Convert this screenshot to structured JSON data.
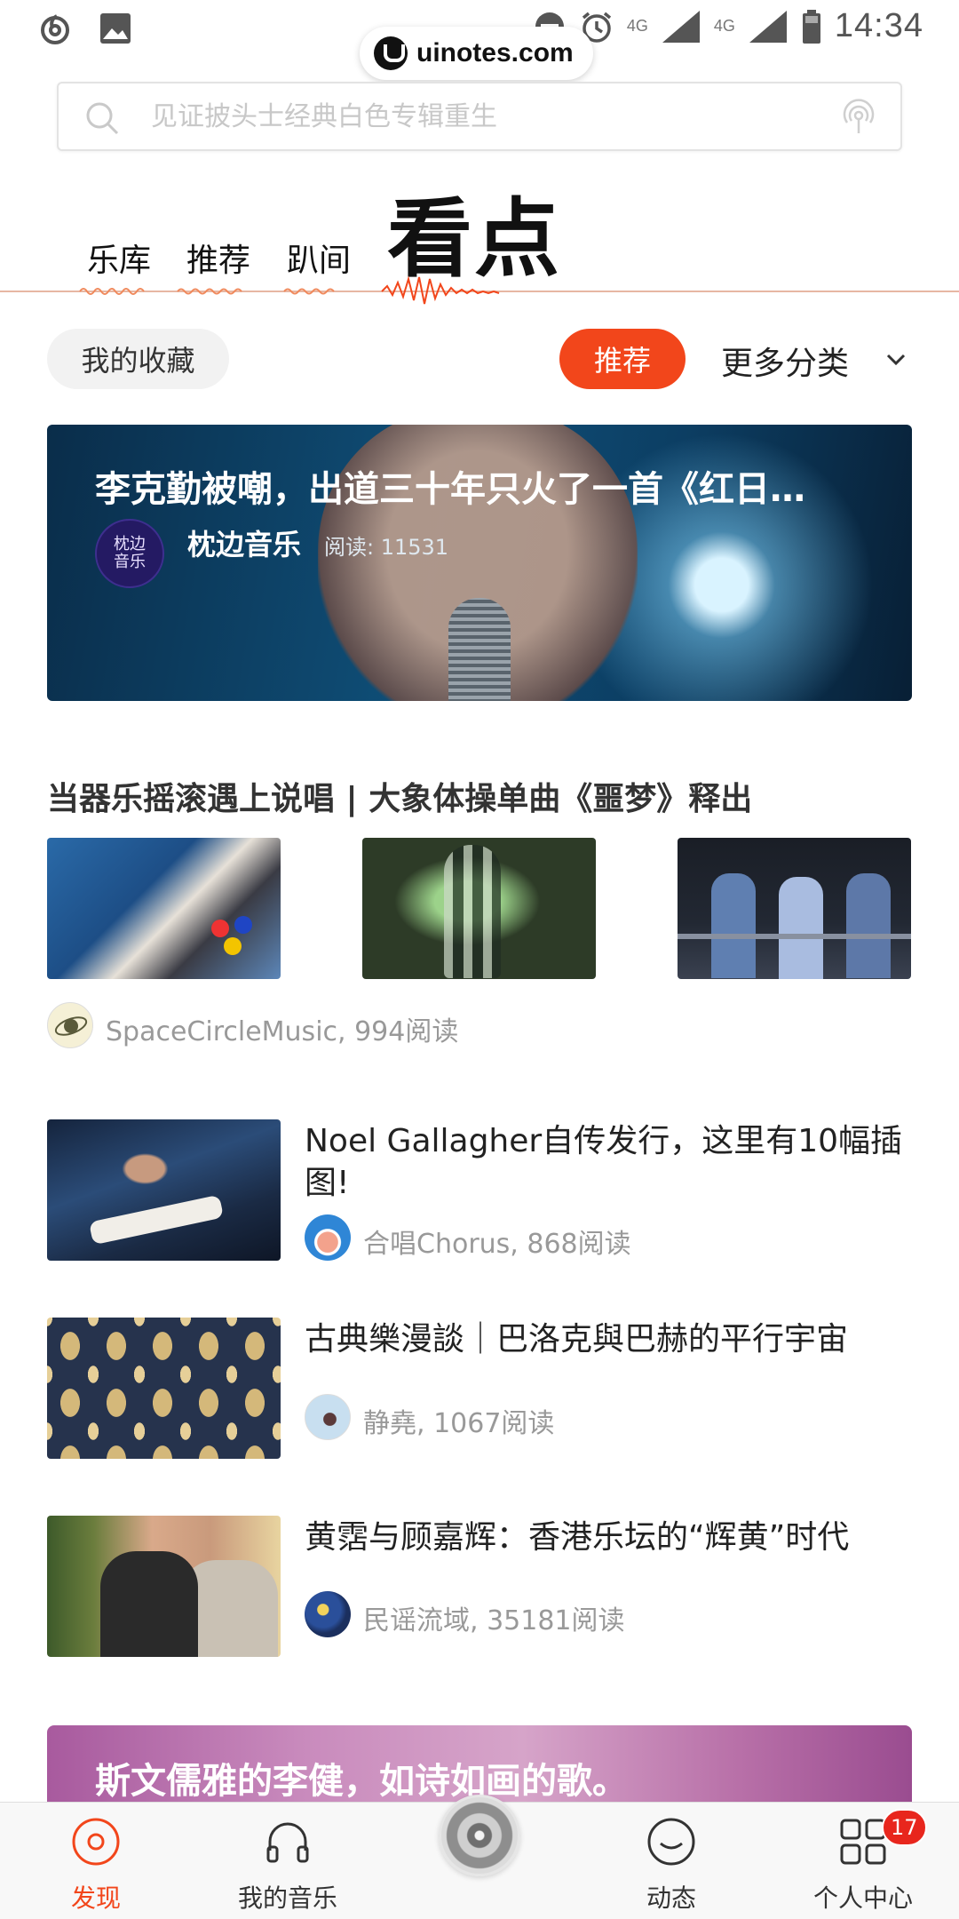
{
  "status_bar": {
    "time": "14:34",
    "network_1": "4G",
    "network_2": "4G",
    "watermark": "uinotes.com"
  },
  "search": {
    "placeholder": "见证披头士经典白色专辑重生"
  },
  "top_tabs": [
    {
      "label": "乐库",
      "active": false
    },
    {
      "label": "推荐",
      "active": false
    },
    {
      "label": "趴间",
      "active": false
    },
    {
      "label": "看点",
      "active": true
    }
  ],
  "filters": {
    "favorites": "我的收藏",
    "recommended": "推荐",
    "more_categories": "更多分类"
  },
  "feature": {
    "title": "李克勤被嘲，出道三十年只火了一首《红日…",
    "avatar_text": "枕边\n音乐",
    "author": "枕边音乐",
    "reads": "阅读: 11531"
  },
  "article_multi": {
    "title": "当器乐摇滚遇上说唱 | 大象体操单曲《噩梦》释出",
    "meta": "SpaceCircleMusic, 994阅读"
  },
  "articles": [
    {
      "title": "Noel Gallagher自传发行，这里有10幅插图!",
      "meta": "合唱Chorus, 868阅读"
    },
    {
      "title": "古典樂漫談｜巴洛克與巴赫的平行宇宙",
      "meta": "静堯, 1067阅读"
    },
    {
      "title": "黄霑与顾嘉辉：香港乐坛的“辉黄”时代",
      "meta": "民谣流域, 35181阅读"
    }
  ],
  "promo": {
    "title": "斯文儒雅的李健，如诗如画的歌。"
  },
  "bottom_nav": [
    {
      "label": "发现",
      "icon": "discover-icon",
      "active": true
    },
    {
      "label": "我的音乐",
      "icon": "headphones-icon",
      "active": false
    },
    {
      "label": "",
      "icon": "now-playing-disc",
      "active": false
    },
    {
      "label": "动态",
      "icon": "smile-icon",
      "active": false
    },
    {
      "label": "个人中心",
      "icon": "grid-icon",
      "active": false
    }
  ],
  "badge_count": "17",
  "colors": {
    "accent": "#f2461b",
    "badge": "#e8261d",
    "meta_text": "#999999"
  }
}
